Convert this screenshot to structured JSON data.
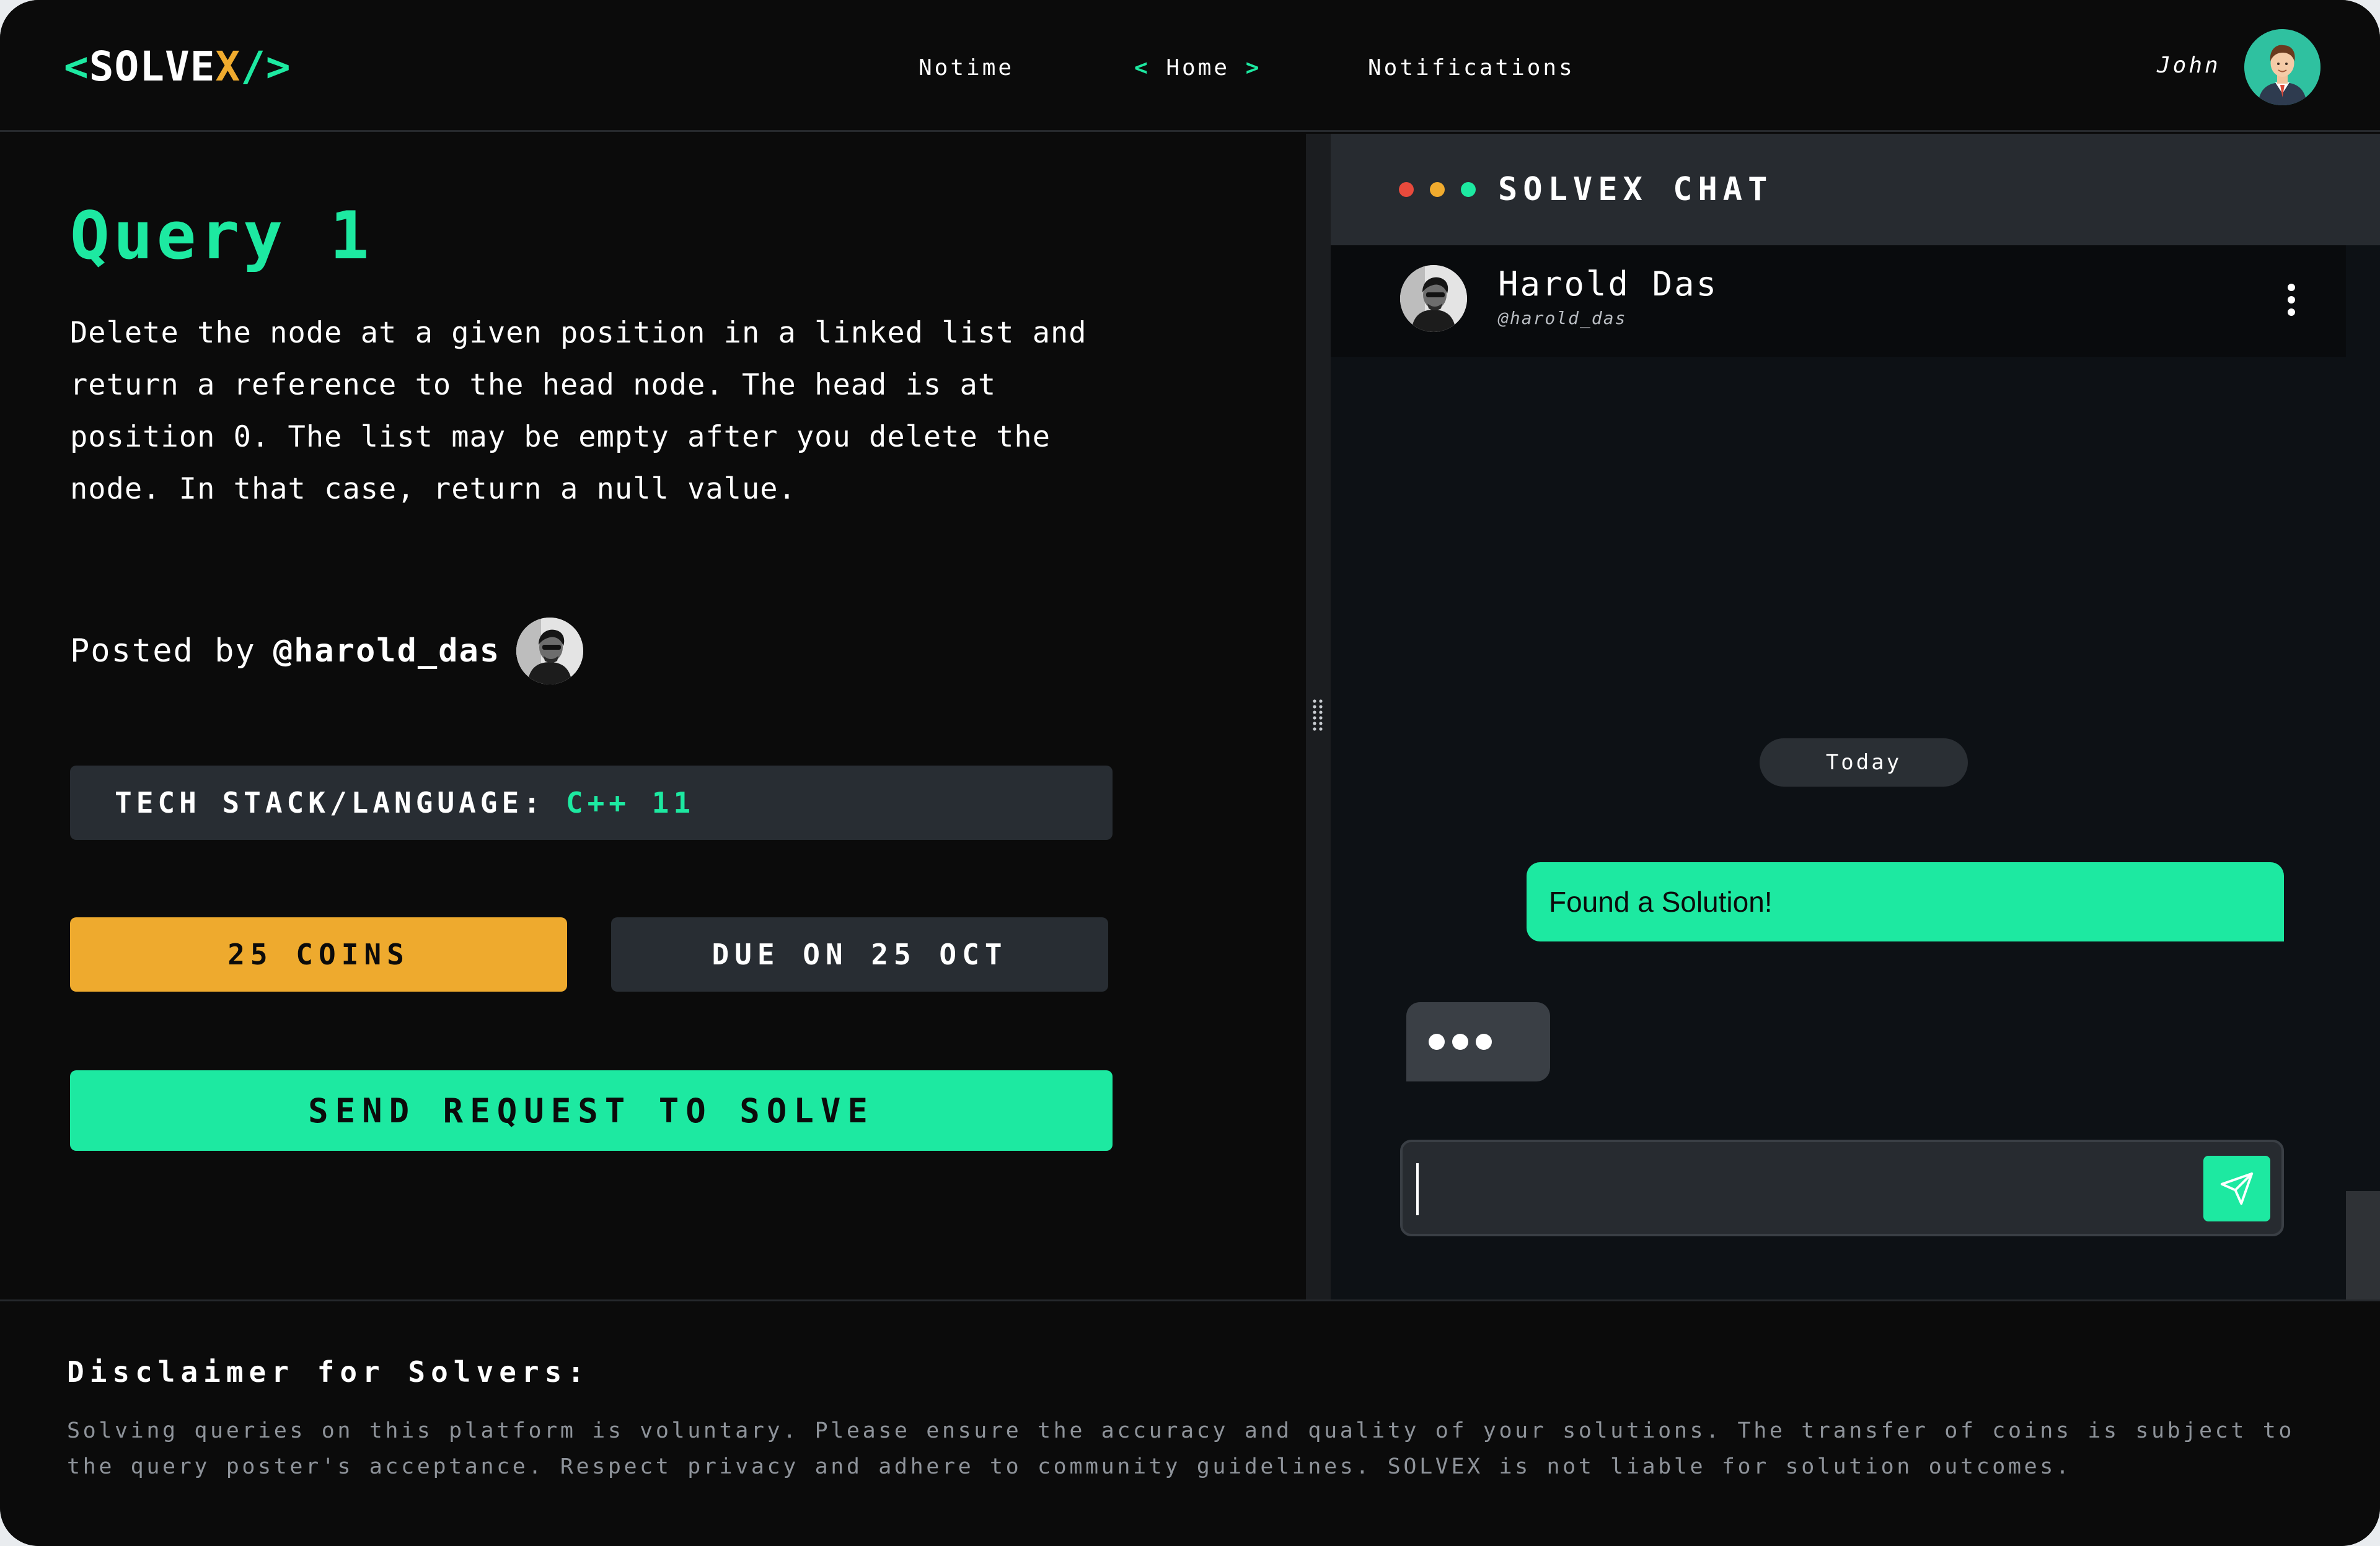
{
  "header": {
    "logo": {
      "open": "<",
      "word": "SOLVE",
      "x": "X",
      "close": "/>"
    },
    "nav": {
      "notime": "Notime",
      "home_left": "<",
      "home": "Home",
      "home_right": ">",
      "notifications": "Notifications"
    },
    "user": {
      "name": "John"
    }
  },
  "query": {
    "title": "Query 1",
    "description": "Delete the node at a given position in a linked list and\nreturn a reference to the head node. The head is at\nposition 0. The list may be empty after you delete the\nnode. In that case, return a null value.",
    "posted_by_label": "Posted by",
    "poster_handle": "@harold_das",
    "tech_stack_label": "TECH STACK/LANGUAGE:",
    "tech_stack_value": "C++ 11",
    "coins": "25 COINS",
    "due": "DUE ON 25 OCT",
    "send_label": "SEND REQUEST TO SOLVE"
  },
  "chat": {
    "title": "SOLVEX CHAT",
    "contact": {
      "name": "Harold Das",
      "handle": "@harold_das"
    },
    "date_separator": "Today",
    "messages": [
      {
        "direction": "outgoing",
        "text": "Found a Solution!"
      }
    ],
    "typing_indicator": true,
    "input": {
      "value": "",
      "placeholder": ""
    }
  },
  "footer": {
    "disclaimer_title": "Disclaimer for Solvers:",
    "disclaimer_text": "Solving queries on this platform is voluntary. Please ensure the accuracy and quality of your solutions. The transfer of coins is subject to the query poster's acceptance. Respect privacy and adhere to community guidelines. SOLVEX is not liable for solution outcomes."
  },
  "colors": {
    "background": "#0b0b0b",
    "accent_green": "#1de9a1",
    "accent_orange": "#eeaa2e",
    "panel_gray": "#282d33",
    "chat_background": "#0d1115",
    "dot_red": "#e84a3c",
    "dot_orange": "#f0ab2e",
    "dot_green": "#1de9a1"
  },
  "icons": {
    "user_avatar": "avatar-man-icon",
    "poster_avatar": "avatar-photo-icon",
    "kebab": "more-vertical-icon",
    "send": "send-plane-icon",
    "drag": "drag-handle-icon"
  }
}
